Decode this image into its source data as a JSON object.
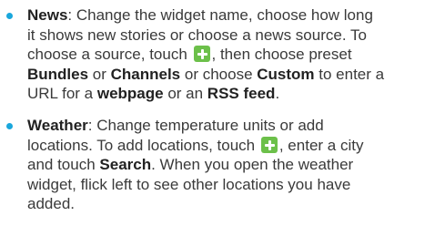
{
  "items": [
    {
      "term": "News",
      "lines": [
        {
          "a": ": Change the widget name, choose how long"
        },
        {
          "a": "it shows new stories or choose a news source. To"
        },
        {
          "a": "choose a source, touch ",
          "b": ", then choose preset"
        },
        {
          "b1": "Bundles",
          "a": " or ",
          "b2": "Channels",
          "c": " or choose ",
          "b3": "Custom",
          "d": " to enter a"
        },
        {
          "a": "URL for a ",
          "b1": "webpage",
          "c": " or an ",
          "b2": "RSS feed",
          "d": "."
        }
      ]
    },
    {
      "term": "Weather",
      "lines": [
        {
          "a": ": Change temperature units or add"
        },
        {
          "a": "locations. To add locations, touch ",
          "b": ", enter a city"
        },
        {
          "a": "and touch ",
          "b1": "Search",
          "c": ". When you open the weather"
        },
        {
          "a": "widget, flick left to see other locations you have"
        },
        {
          "a": "added."
        }
      ]
    }
  ],
  "icons": {
    "plus": "plus-icon",
    "plus_color": "#6cc04a",
    "bullet_color": "#1aa7dc"
  }
}
